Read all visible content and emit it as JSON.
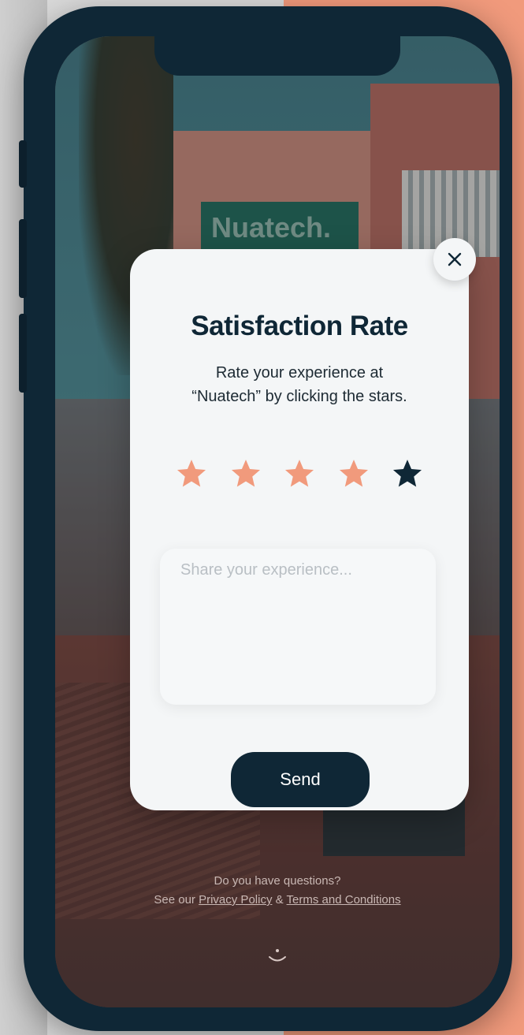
{
  "modal": {
    "title": "Satisfaction Rate",
    "subtitle_line1": "Rate your experience at",
    "subtitle_line2": "“Nuatech” by clicking the stars.",
    "rating": {
      "value": 4,
      "max": 5
    },
    "stars": [
      {
        "state": "filled",
        "color": "#f19a7c"
      },
      {
        "state": "filled",
        "color": "#f19a7c"
      },
      {
        "state": "filled",
        "color": "#f19a7c"
      },
      {
        "state": "filled",
        "color": "#f19a7c"
      },
      {
        "state": "empty",
        "color": "#0f2736"
      }
    ],
    "textarea_placeholder": "Share your experience...",
    "send_label": "Send",
    "close_icon": "close-icon"
  },
  "background": {
    "sign_text": "Nuatech."
  },
  "footer": {
    "question": "Do you have questions?",
    "prefix": "See our",
    "privacy_link": "Privacy Policy",
    "ampersand": "&",
    "terms_link": "Terms and Conditions"
  },
  "colors": {
    "accent": "#f19a7c",
    "primary_dark": "#0f2736",
    "modal_bg": "#f4f6f7"
  }
}
